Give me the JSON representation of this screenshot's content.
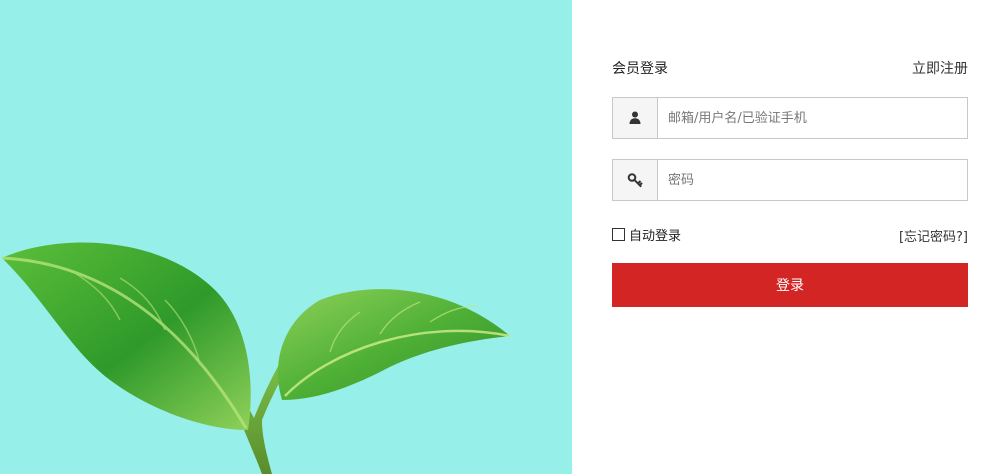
{
  "hero": {
    "background_color": "#97efea",
    "illustration": "leaf-sprout-illustration"
  },
  "login": {
    "title": "会员登录",
    "register_label": "立即注册",
    "username": {
      "icon": "user-icon",
      "placeholder": "邮箱/用户名/已验证手机",
      "value": ""
    },
    "password": {
      "icon": "key-icon",
      "placeholder": "密码",
      "value": ""
    },
    "remember": {
      "label": "自动登录",
      "checked": false
    },
    "forgot_label": "[忘记密码?]",
    "submit_label": "登录",
    "accent_color": "#d42525"
  }
}
